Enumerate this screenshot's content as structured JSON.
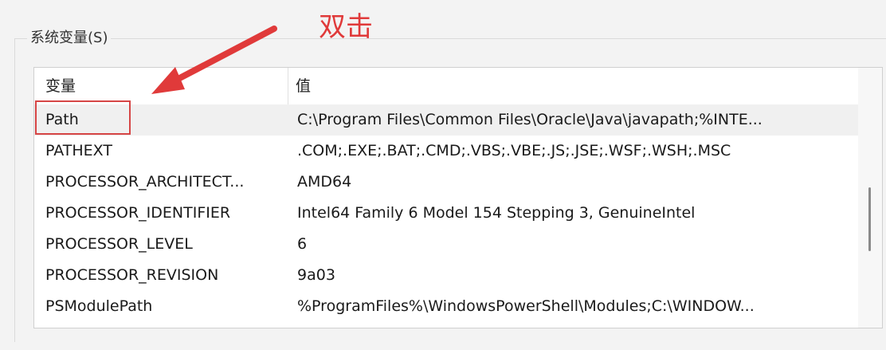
{
  "groupbox": {
    "title": "系统变量(S)"
  },
  "annotation": {
    "label": "双击",
    "color": "#e03a3a"
  },
  "table": {
    "headers": {
      "name": "变量",
      "value": "值"
    },
    "rows": [
      {
        "name": "Path",
        "value": "C:\\Program Files\\Common Files\\Oracle\\Java\\javapath;%INTE...",
        "selected": true
      },
      {
        "name": "PATHEXT",
        "value": ".COM;.EXE;.BAT;.CMD;.VBS;.VBE;.JS;.JSE;.WSF;.WSH;.MSC"
      },
      {
        "name": "PROCESSOR_ARCHITECT...",
        "value": "AMD64"
      },
      {
        "name": "PROCESSOR_IDENTIFIER",
        "value": "Intel64 Family 6 Model 154 Stepping 3, GenuineIntel"
      },
      {
        "name": "PROCESSOR_LEVEL",
        "value": "6"
      },
      {
        "name": "PROCESSOR_REVISION",
        "value": "9a03"
      },
      {
        "name": "PSModulePath",
        "value": "%ProgramFiles%\\WindowsPowerShell\\Modules;C:\\WINDOW..."
      }
    ]
  }
}
